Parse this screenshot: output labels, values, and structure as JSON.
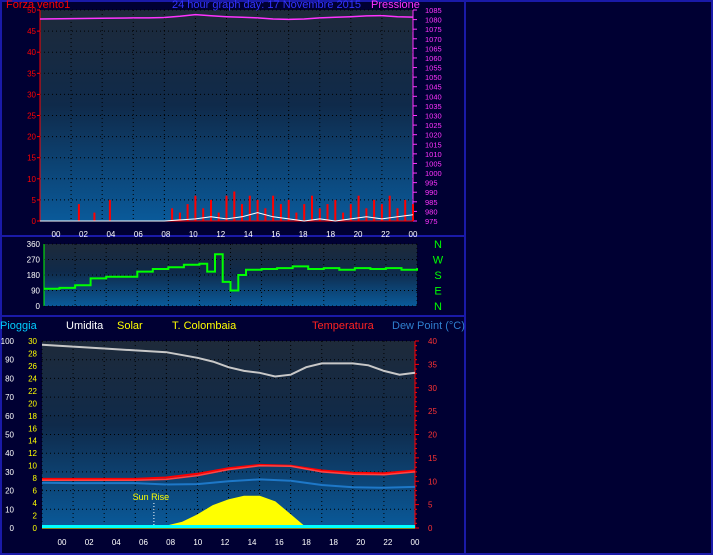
{
  "header": {
    "wind_label": "Forza vento1",
    "title": "24 hour graph day:  17 Novembre 2015",
    "pressure_label": "Pressione",
    "rain_label": "Pioggia",
    "humidity_label": "Umidita",
    "solar_label": "Solar",
    "colombaia_label": "T. Colombaia",
    "temp_label": "Temperatura",
    "dew_label": "Dew Point (°C)",
    "sunrise_label": "Sun Rise"
  },
  "colors": {
    "wind": "#ff0000",
    "gust": "#ffffff",
    "pressure": "#ff33ff",
    "direction": "#00ff00",
    "rain": "#00ffff",
    "humidity": "#c8c8c8",
    "solar": "#ffff00",
    "colombaia": "#ff4444",
    "temperature": "#ff0000",
    "dew": "#1e78c8",
    "title": "#3333ff",
    "frame": "#1a1aa8"
  },
  "x_ticks": [
    "00",
    "02",
    "04",
    "06",
    "08",
    "10",
    "12",
    "14",
    "16",
    "18",
    "18",
    "20",
    "22",
    "00"
  ],
  "chart_data": [
    {
      "type": "line",
      "name": "wind-pressure",
      "title": "24 hour graph day:  17 Novembre 2015",
      "left_axis": {
        "label": "Forza vento1",
        "min": 0,
        "max": 50,
        "ticks": [
          0,
          5,
          10,
          15,
          20,
          25,
          30,
          35,
          40,
          45,
          50
        ]
      },
      "right_axis": {
        "label": "Pressione",
        "min": 975,
        "max": 1085,
        "ticks": [
          975,
          980,
          985,
          990,
          995,
          1000,
          1005,
          1010,
          1015,
          1020,
          1025,
          1030,
          1035,
          1040,
          1045,
          1050,
          1055,
          1060,
          1065,
          1070,
          1075,
          1080,
          1085
        ]
      },
      "x_hours": [
        0,
        24
      ],
      "series": [
        {
          "name": "Pressione",
          "axis": "right",
          "x": [
            0,
            2,
            4,
            6,
            7,
            8,
            9,
            10,
            11,
            12,
            13,
            14,
            15,
            16,
            17,
            18,
            19,
            20,
            21,
            22,
            23,
            24
          ],
          "y": [
            1080.3,
            1080.5,
            1080.7,
            1080.9,
            1080.9,
            1081.1,
            1081.7,
            1082.6,
            1082.0,
            1081.5,
            1081.2,
            1080.9,
            1080.3,
            1080.1,
            1080.3,
            1080.9,
            1081.2,
            1081.5,
            1081.9,
            1082.1,
            1081.5,
            1081.3
          ]
        },
        {
          "name": "Forza vento1",
          "axis": "left",
          "x": [
            0,
            1,
            2,
            2.5,
            3,
            3.5,
            4,
            4.5,
            5,
            6,
            7,
            8,
            8.5,
            9,
            9.5,
            10,
            10.5,
            11,
            11.5,
            12,
            12.5,
            13,
            13.5,
            14,
            14.5,
            15,
            15.5,
            16,
            16.5,
            17,
            17.5,
            18,
            18.5,
            19,
            19.5,
            20,
            20.5,
            21,
            21.5,
            22,
            22.5,
            23,
            23.5,
            24
          ],
          "y": [
            0,
            0,
            0,
            4,
            0,
            2,
            0,
            5,
            0,
            0,
            0,
            0,
            3,
            2,
            4,
            6,
            3,
            5,
            2,
            6,
            7,
            4,
            6,
            5,
            3,
            6,
            4,
            5,
            2,
            4,
            6,
            3,
            4,
            5,
            2,
            4,
            6,
            3,
            5,
            4,
            6,
            3,
            5,
            4
          ]
        },
        {
          "name": "Raffica",
          "axis": "left",
          "x": [
            0,
            4,
            8,
            10,
            11,
            12,
            13,
            14,
            15,
            16,
            17,
            18,
            19,
            20,
            21,
            22,
            23,
            24
          ],
          "y": [
            0,
            0,
            0,
            0.5,
            1,
            0.5,
            1,
            2,
            1,
            0.5,
            0,
            0.5,
            0,
            0.5,
            1,
            0.5,
            1,
            1.5
          ]
        }
      ]
    },
    {
      "type": "line",
      "name": "wind-direction",
      "axis": {
        "min": 0,
        "max": 360,
        "ticks": [
          0,
          90,
          180,
          270,
          360
        ]
      },
      "direction_labels": [
        "N",
        "W",
        "S",
        "E",
        "N"
      ],
      "series": [
        {
          "name": "direction",
          "x": [
            0,
            1,
            2,
            3,
            4,
            6,
            7,
            8,
            9,
            10,
            10.5,
            11,
            11.5,
            12,
            12.5,
            13,
            14,
            15,
            16,
            17,
            18,
            19,
            20,
            21,
            22,
            23,
            24
          ],
          "y": [
            100,
            105,
            120,
            160,
            170,
            200,
            215,
            225,
            240,
            245,
            200,
            300,
            140,
            90,
            180,
            210,
            215,
            220,
            230,
            215,
            220,
            210,
            220,
            215,
            220,
            210,
            220
          ]
        }
      ]
    },
    {
      "type": "line",
      "name": "temp-humidity",
      "axes": {
        "rain": {
          "label": "Pioggia",
          "min": 0,
          "max": 100,
          "ticks": [
            0,
            10,
            20,
            30,
            40,
            50,
            60,
            70,
            80,
            90,
            100
          ]
        },
        "humidity": {
          "label": "Umidita",
          "min": 0,
          "max": 30,
          "ticks": [
            0,
            2,
            4,
            6,
            8,
            10,
            12,
            14,
            16,
            18,
            20,
            22,
            24,
            26,
            28,
            30
          ]
        },
        "temperature": {
          "label": "Temperatura",
          "min": 0,
          "max": 40,
          "ticks": [
            0,
            5,
            10,
            15,
            20,
            25,
            30,
            35,
            40
          ]
        }
      },
      "sunrise_hour": 7.2,
      "series": [
        {
          "name": "Umidita",
          "axis": "rain",
          "x": [
            0,
            2,
            4,
            6,
            8,
            10,
            11,
            12,
            13,
            14,
            15,
            16,
            17,
            18,
            19,
            20,
            21,
            22,
            23,
            24
          ],
          "y": [
            98,
            97,
            96,
            95,
            94,
            91,
            89,
            86,
            84,
            83,
            81,
            82,
            86,
            88,
            88,
            88,
            87,
            84,
            82,
            83
          ]
        },
        {
          "name": "Solar",
          "axis": "rain",
          "x": [
            0,
            7,
            8,
            9,
            10,
            11,
            12,
            13,
            14,
            15,
            16,
            17,
            24
          ],
          "y": [
            0,
            0,
            1,
            3,
            7,
            12,
            15,
            17,
            17,
            14,
            7,
            0,
            0
          ]
        },
        {
          "name": "T. Colombaia",
          "axis": "temperature",
          "x": [
            0,
            2,
            4,
            6,
            8,
            10,
            12,
            14,
            16,
            18,
            20,
            22,
            24
          ],
          "y": [
            10.2,
            10.2,
            10.2,
            10.2,
            10.4,
            11.2,
            12.5,
            13.3,
            13.2,
            12,
            11.5,
            11.4,
            12
          ]
        },
        {
          "name": "Temperatura",
          "axis": "temperature",
          "x": [
            0,
            2,
            4,
            6,
            8,
            10,
            12,
            14,
            16,
            18,
            20,
            22,
            24
          ],
          "y": [
            10.5,
            10.5,
            10.5,
            10.5,
            10.8,
            11.6,
            12.8,
            13.5,
            13.3,
            12.3,
            11.8,
            11.7,
            12.3
          ]
        },
        {
          "name": "Dew Point (°C)",
          "axis": "temperature",
          "x": [
            0,
            2,
            4,
            6,
            8,
            10,
            12,
            14,
            16,
            18,
            20,
            22,
            24
          ],
          "y": [
            9.7,
            9.6,
            9.6,
            9.6,
            9.3,
            9.4,
            10,
            10.4,
            10.1,
            9.2,
            8.7,
            8.6,
            8.8
          ]
        },
        {
          "name": "Pioggia",
          "axis": "rain",
          "x": [
            0,
            24
          ],
          "y": [
            0,
            0
          ]
        }
      ]
    }
  ]
}
